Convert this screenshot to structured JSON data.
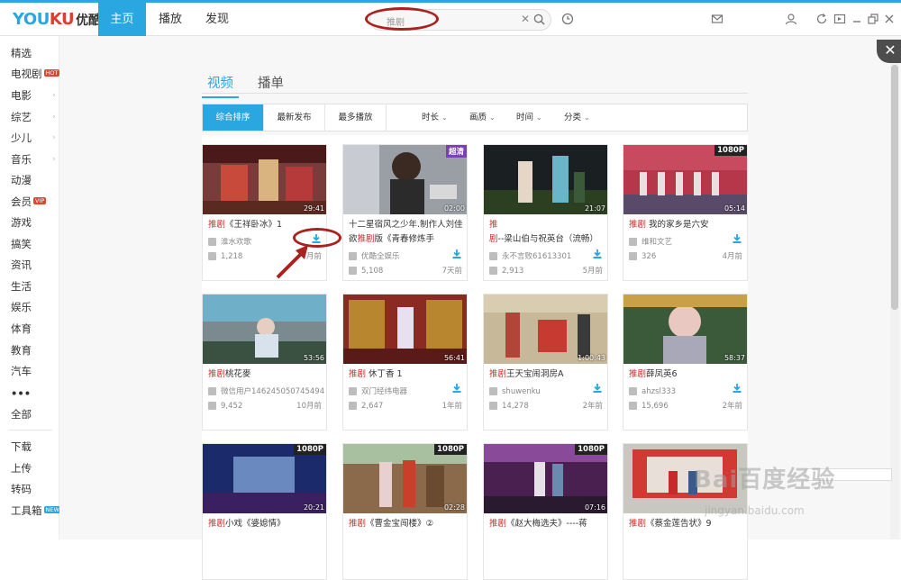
{
  "brand": {
    "logo_latin_a": "YOU",
    "logo_latin_b": "KU",
    "logo_cn": "优酷"
  },
  "nav": {
    "tabs": [
      "主页",
      "播放",
      "发现"
    ],
    "active": 0
  },
  "search": {
    "placeholder": "推剧",
    "clear_icon": "close-icon",
    "search_icon": "search-icon"
  },
  "topbar_icons": [
    "history-icon",
    "message-icon",
    "user-icon",
    "refresh-icon",
    "mini-mode-icon",
    "minimize-icon",
    "restore-icon",
    "close-icon"
  ],
  "sidebar": {
    "channels": [
      {
        "label": "精选"
      },
      {
        "label": "电视剧",
        "badge": "HOT"
      },
      {
        "label": "电影",
        "arrow": true
      },
      {
        "label": "综艺",
        "arrow": true
      },
      {
        "label": "少儿",
        "arrow": true
      },
      {
        "label": "音乐",
        "arrow": true
      },
      {
        "label": "动漫"
      },
      {
        "label": "会员",
        "badge": "VIP"
      },
      {
        "label": "游戏"
      },
      {
        "label": "搞笑"
      },
      {
        "label": "资讯"
      },
      {
        "label": "生活"
      },
      {
        "label": "娱乐"
      },
      {
        "label": "体育"
      },
      {
        "label": "教育"
      },
      {
        "label": "汽车"
      },
      {
        "label": "•••"
      },
      {
        "label": "全部"
      }
    ],
    "tools": [
      {
        "label": "下载"
      },
      {
        "label": "上传"
      },
      {
        "label": "转码"
      },
      {
        "label": "工具箱",
        "badge": "NEW"
      }
    ]
  },
  "tabs": {
    "items": [
      "视频",
      "播单"
    ],
    "active": 0
  },
  "filter": {
    "sorts": [
      "综合排序",
      "最新发布",
      "最多播放"
    ],
    "active_sort": 0,
    "dropdowns": [
      "时长",
      "画质",
      "时间",
      "分类"
    ]
  },
  "videos": [
    {
      "title_hl": "推剧",
      "title_rest": "《王祥卧冰》1",
      "uploader": "淮水欢歌",
      "plays": "1,218",
      "time": "月前",
      "duration": "29:41",
      "badge": ""
    },
    {
      "title_hl": "",
      "title_rest": "十二星宿风之少年.制作人刘佳欲",
      "title_hl2": "推剧",
      "title_rest2": "版《青春修炼手",
      "uploader": "优酷全娱乐",
      "plays": "5,108",
      "time": "7天前",
      "duration": "02:00",
      "badge": "超清"
    },
    {
      "title_hl": "推剧",
      "title_rest": "--梁山伯与祝英台（流畅）",
      "uploader": "永不言败61613301",
      "plays": "2,913",
      "time": "5月前",
      "duration": "21:07",
      "badge": ""
    },
    {
      "title_hl": "推剧",
      "title_rest": " 我的家乡是六安",
      "uploader": "维和文艺",
      "plays": "326",
      "time": "4月前",
      "duration": "05:14",
      "badge": "1080P"
    },
    {
      "title_hl": "推剧",
      "title_rest": "桃花麥",
      "uploader": "微信用户146245050745494",
      "plays": "9,452",
      "time": "10月前",
      "duration": "53:56",
      "badge": ""
    },
    {
      "title_hl": "推剧",
      "title_rest": " 休丁香 1",
      "uploader": "双门经纬电器",
      "plays": "2,647",
      "time": "1年前",
      "duration": "56:41",
      "badge": ""
    },
    {
      "title_hl": "推剧",
      "title_rest": "王天宝闹洞房A",
      "uploader": "shuwenku",
      "plays": "14,278",
      "time": "2年前",
      "duration": "1:00:43",
      "badge": ""
    },
    {
      "title_hl": "推剧",
      "title_rest": "薛凤英6",
      "uploader": "ahzsl333",
      "plays": "15,696",
      "time": "2年前",
      "duration": "58:37",
      "badge": ""
    },
    {
      "title_hl": "推剧",
      "title_rest": "小戏《婆媳情》",
      "uploader": "",
      "plays": "",
      "time": "",
      "duration": "20:21",
      "badge": "1080P"
    },
    {
      "title_hl": "推剧",
      "title_rest": "《曹金宝闯楼》②",
      "uploader": "",
      "plays": "",
      "time": "",
      "duration": "02:28",
      "badge": "1080P"
    },
    {
      "title_hl": "推剧",
      "title_rest": "《赵大梅选夫》----蒋",
      "uploader": "",
      "plays": "",
      "time": "",
      "duration": "07:16",
      "badge": "1080P"
    },
    {
      "title_hl": "推剧",
      "title_rest": "《蔡金莲告状》9",
      "uploader": "",
      "plays": "",
      "time": "",
      "duration": "",
      "badge": ""
    }
  ],
  "watermark": {
    "brand": "Bai百度经验",
    "url": "jingyan.baidu.com"
  },
  "colors": {
    "accent": "#2aa6e0",
    "highlight": "#c9302c",
    "annotation": "#a8231f"
  }
}
